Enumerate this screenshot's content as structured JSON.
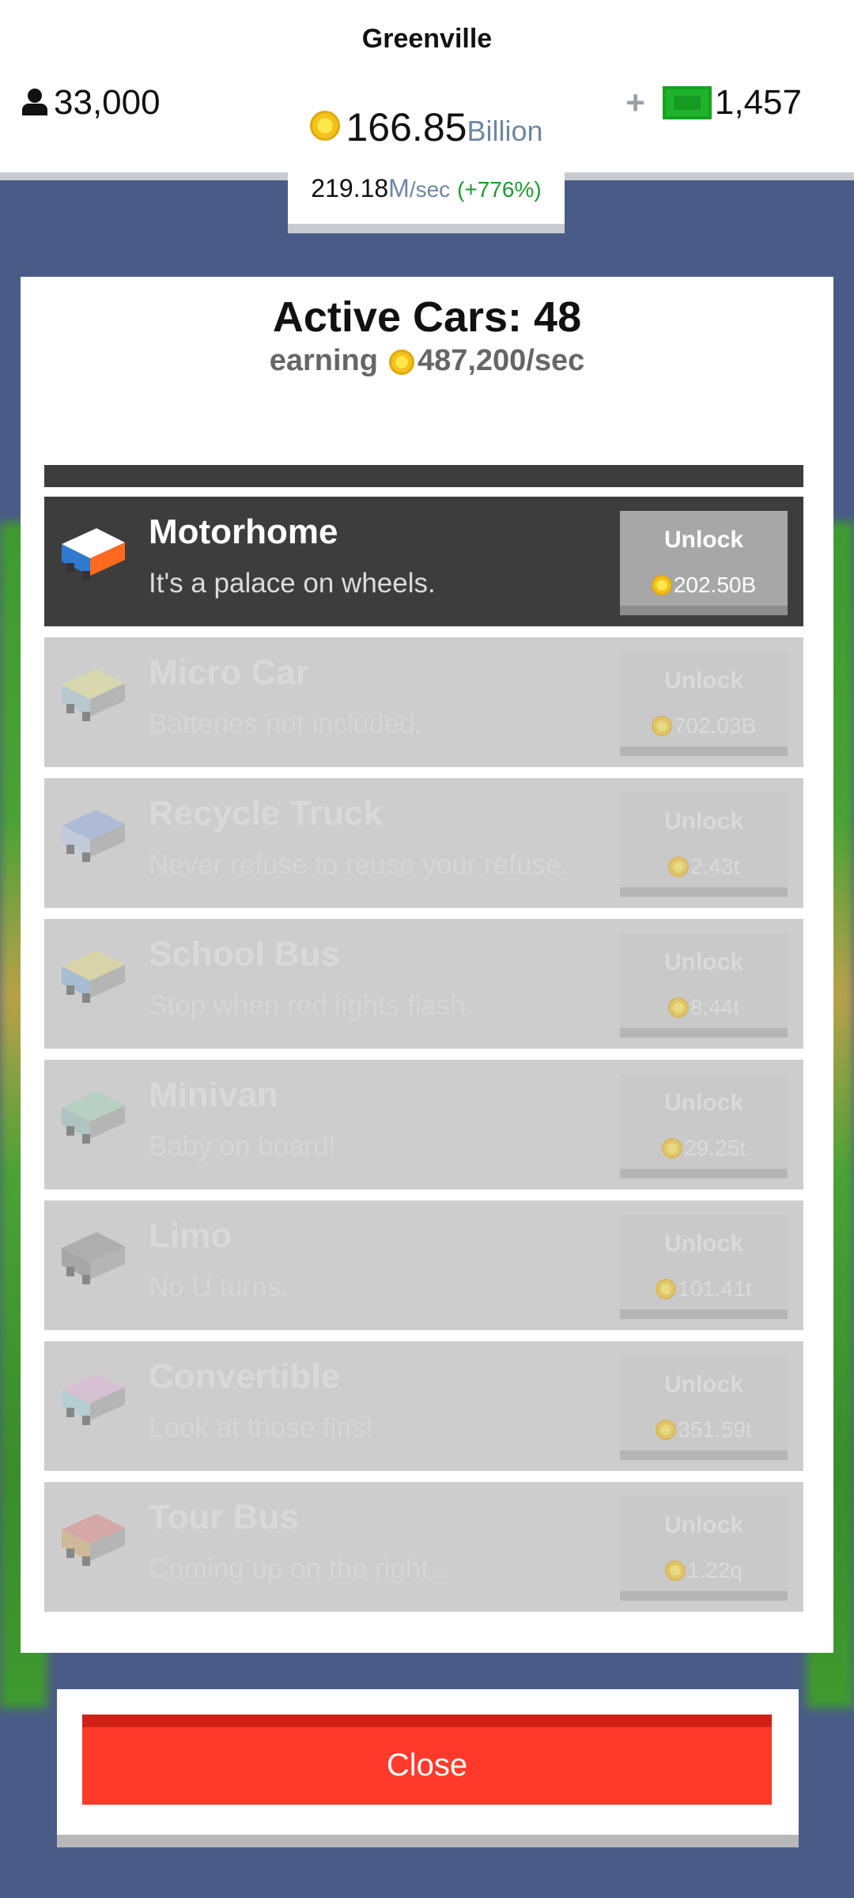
{
  "header": {
    "city": "Greenville",
    "population": "33,000",
    "money_value": "166.85",
    "money_unit": "Billion",
    "rate_value": "219.18",
    "rate_unit": "M",
    "rate_per": "/sec",
    "rate_pct": "(+776%)",
    "cash_plus": "+",
    "cash_value": "1,457"
  },
  "panel": {
    "title": "Active Cars: 48",
    "earning_label": "earning",
    "earning_value": "487,200/sec"
  },
  "cars": [
    {
      "name": "Motorhome",
      "desc": "It's a palace on wheels.",
      "unlock": "Unlock",
      "price": "202.50B",
      "active": true,
      "colors": [
        "#ffffff",
        "#2f7ad1",
        "#ff6a21"
      ]
    },
    {
      "name": "Micro Car",
      "desc": "Batteries not included.",
      "unlock": "Unlock",
      "price": "702.03B",
      "active": false,
      "colors": [
        "#e9e48a",
        "#9ec4d6",
        "#9a9a9a"
      ]
    },
    {
      "name": "Recycle Truck",
      "desc": "Never refuse to reuse your refuse.",
      "unlock": "Unlock",
      "price": "2.43t",
      "active": false,
      "colors": [
        "#8aa6e2",
        "#b9c7e8",
        "#9a9a9a"
      ]
    },
    {
      "name": "School Bus",
      "desc": "Stop when red lights flash.",
      "unlock": "Unlock",
      "price": "8.44t",
      "active": false,
      "colors": [
        "#e6dc7d",
        "#7aa8d9",
        "#9a9a9a"
      ]
    },
    {
      "name": "Minivan",
      "desc": "Baby on board!",
      "unlock": "Unlock",
      "price": "29.25t",
      "active": false,
      "colors": [
        "#9fd3b7",
        "#8bbbb3",
        "#9a9a9a"
      ]
    },
    {
      "name": "Limo",
      "desc": "No U turns.",
      "unlock": "Unlock",
      "price": "101.41t",
      "active": false,
      "colors": [
        "#8a8a8a",
        "#7a7a7a",
        "#9a9a9a"
      ]
    },
    {
      "name": "Convertible",
      "desc": "Look at those fins!",
      "unlock": "Unlock",
      "price": "351.59t",
      "active": false,
      "colors": [
        "#e7b2dc",
        "#9cd1d6",
        "#9a9a9a"
      ]
    },
    {
      "name": "Tour Bus",
      "desc": "Coming up on the right...",
      "unlock": "Unlock",
      "price": "1.22q",
      "active": false,
      "colors": [
        "#e07a7a",
        "#d1a45a",
        "#9a9a9a"
      ]
    }
  ],
  "close_label": "Close"
}
